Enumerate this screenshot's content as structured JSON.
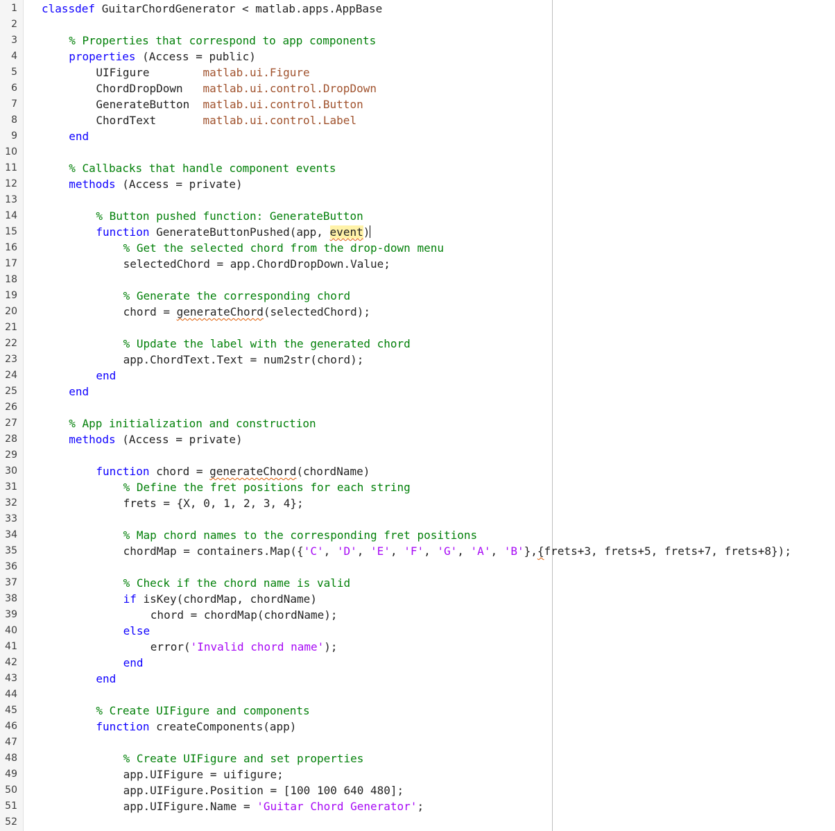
{
  "editor": {
    "line_numbers": [
      "1",
      "2",
      "3",
      "4",
      "5",
      "6",
      "7",
      "8",
      "9",
      "10",
      "11",
      "12",
      "13",
      "14",
      "15",
      "16",
      "17",
      "18",
      "19",
      "20",
      "21",
      "22",
      "23",
      "24",
      "25",
      "26",
      "27",
      "28",
      "29",
      "30",
      "31",
      "32",
      "33",
      "34",
      "35",
      "36",
      "37",
      "38",
      "39",
      "40",
      "41",
      "42",
      "43",
      "44",
      "45",
      "46",
      "47",
      "48",
      "49",
      "50",
      "51",
      "52"
    ],
    "lines": [
      {
        "n": 1,
        "indent": 0,
        "tokens": [
          {
            "t": "classdef",
            "c": "kw"
          },
          {
            "t": " GuitarChordGenerator < matlab.apps.AppBase",
            "c": ""
          }
        ]
      },
      {
        "n": 2,
        "indent": 0,
        "tokens": []
      },
      {
        "n": 3,
        "indent": 4,
        "tokens": [
          {
            "t": "% Properties that correspond to app components",
            "c": "cm"
          }
        ]
      },
      {
        "n": 4,
        "indent": 4,
        "tokens": [
          {
            "t": "properties",
            "c": "kw"
          },
          {
            "t": " (Access = public)",
            "c": ""
          }
        ]
      },
      {
        "n": 5,
        "indent": 8,
        "tokens": [
          {
            "t": "UIFigure        ",
            "c": ""
          },
          {
            "t": "matlab.ui.Figure",
            "c": "ty"
          }
        ]
      },
      {
        "n": 6,
        "indent": 8,
        "tokens": [
          {
            "t": "ChordDropDown   ",
            "c": ""
          },
          {
            "t": "matlab.ui.control.DropDown",
            "c": "ty"
          }
        ]
      },
      {
        "n": 7,
        "indent": 8,
        "tokens": [
          {
            "t": "GenerateButton  ",
            "c": ""
          },
          {
            "t": "matlab.ui.control.Button",
            "c": "ty"
          }
        ]
      },
      {
        "n": 8,
        "indent": 8,
        "tokens": [
          {
            "t": "ChordText       ",
            "c": ""
          },
          {
            "t": "matlab.ui.control.Label",
            "c": "ty"
          }
        ]
      },
      {
        "n": 9,
        "indent": 4,
        "tokens": [
          {
            "t": "end",
            "c": "kw"
          }
        ]
      },
      {
        "n": 10,
        "indent": 0,
        "tokens": []
      },
      {
        "n": 11,
        "indent": 4,
        "tokens": [
          {
            "t": "% Callbacks that handle component events",
            "c": "cm"
          }
        ]
      },
      {
        "n": 12,
        "indent": 4,
        "tokens": [
          {
            "t": "methods",
            "c": "kw"
          },
          {
            "t": " (Access = private)",
            "c": ""
          }
        ]
      },
      {
        "n": 13,
        "indent": 0,
        "tokens": []
      },
      {
        "n": 14,
        "indent": 8,
        "tokens": [
          {
            "t": "% Button pushed function: GenerateButton",
            "c": "cm"
          }
        ]
      },
      {
        "n": 15,
        "indent": 8,
        "tokens": [
          {
            "t": "function",
            "c": "kw"
          },
          {
            "t": " GenerateButtonPushed(app, ",
            "c": ""
          },
          {
            "t": "event",
            "c": "hl squig"
          },
          {
            "t": ")",
            "c": ""
          },
          {
            "t": "",
            "c": "caret"
          }
        ]
      },
      {
        "n": 16,
        "indent": 12,
        "tokens": [
          {
            "t": "% Get the selected chord from the drop-down menu",
            "c": "cm"
          }
        ]
      },
      {
        "n": 17,
        "indent": 12,
        "tokens": [
          {
            "t": "selectedChord = app.ChordDropDown.Value;",
            "c": ""
          }
        ]
      },
      {
        "n": 18,
        "indent": 0,
        "tokens": []
      },
      {
        "n": 19,
        "indent": 12,
        "tokens": [
          {
            "t": "% Generate the corresponding chord",
            "c": "cm"
          }
        ]
      },
      {
        "n": 20,
        "indent": 12,
        "tokens": [
          {
            "t": "chord = ",
            "c": ""
          },
          {
            "t": "generateChord",
            "c": "squig"
          },
          {
            "t": "(selectedChord);",
            "c": ""
          }
        ]
      },
      {
        "n": 21,
        "indent": 0,
        "tokens": []
      },
      {
        "n": 22,
        "indent": 12,
        "tokens": [
          {
            "t": "% Update the label with the generated chord",
            "c": "cm"
          }
        ]
      },
      {
        "n": 23,
        "indent": 12,
        "tokens": [
          {
            "t": "app.ChordText.Text = num2str(chord);",
            "c": ""
          }
        ]
      },
      {
        "n": 24,
        "indent": 8,
        "tokens": [
          {
            "t": "end",
            "c": "kw"
          }
        ]
      },
      {
        "n": 25,
        "indent": 4,
        "tokens": [
          {
            "t": "end",
            "c": "kw"
          }
        ]
      },
      {
        "n": 26,
        "indent": 0,
        "tokens": []
      },
      {
        "n": 27,
        "indent": 4,
        "tokens": [
          {
            "t": "% App initialization and construction",
            "c": "cm"
          }
        ]
      },
      {
        "n": 28,
        "indent": 4,
        "tokens": [
          {
            "t": "methods",
            "c": "kw"
          },
          {
            "t": " (Access = private)",
            "c": ""
          }
        ]
      },
      {
        "n": 29,
        "indent": 0,
        "tokens": []
      },
      {
        "n": 30,
        "indent": 8,
        "tokens": [
          {
            "t": "function",
            "c": "kw"
          },
          {
            "t": " chord = ",
            "c": ""
          },
          {
            "t": "generateChord",
            "c": "squig"
          },
          {
            "t": "(chordName)",
            "c": ""
          }
        ]
      },
      {
        "n": 31,
        "indent": 12,
        "tokens": [
          {
            "t": "% Define the fret positions for each string",
            "c": "cm"
          }
        ]
      },
      {
        "n": 32,
        "indent": 12,
        "tokens": [
          {
            "t": "frets = {X, 0, 1, 2, 3, 4};",
            "c": ""
          }
        ]
      },
      {
        "n": 33,
        "indent": 0,
        "tokens": []
      },
      {
        "n": 34,
        "indent": 12,
        "tokens": [
          {
            "t": "% Map chord names to the corresponding fret positions",
            "c": "cm"
          }
        ]
      },
      {
        "n": 35,
        "indent": 12,
        "tokens": [
          {
            "t": "chordMap = containers.Map({",
            "c": ""
          },
          {
            "t": "'C'",
            "c": "st"
          },
          {
            "t": ", ",
            "c": ""
          },
          {
            "t": "'D'",
            "c": "st"
          },
          {
            "t": ", ",
            "c": ""
          },
          {
            "t": "'E'",
            "c": "st"
          },
          {
            "t": ", ",
            "c": ""
          },
          {
            "t": "'F'",
            "c": "st"
          },
          {
            "t": ", ",
            "c": ""
          },
          {
            "t": "'G'",
            "c": "st"
          },
          {
            "t": ", ",
            "c": ""
          },
          {
            "t": "'A'",
            "c": "st"
          },
          {
            "t": ", ",
            "c": ""
          },
          {
            "t": "'B'",
            "c": "st"
          },
          {
            "t": "},",
            "c": ""
          },
          {
            "t": "{",
            "c": "squig"
          },
          {
            "t": "frets+3, frets+5, frets+7, frets+8});",
            "c": ""
          }
        ]
      },
      {
        "n": 36,
        "indent": 0,
        "tokens": []
      },
      {
        "n": 37,
        "indent": 12,
        "tokens": [
          {
            "t": "% Check if the chord name is valid",
            "c": "cm"
          }
        ]
      },
      {
        "n": 38,
        "indent": 12,
        "tokens": [
          {
            "t": "if",
            "c": "kw"
          },
          {
            "t": " isKey(chordMap, chordName)",
            "c": ""
          }
        ]
      },
      {
        "n": 39,
        "indent": 16,
        "tokens": [
          {
            "t": "chord = chordMap(chordName);",
            "c": ""
          }
        ]
      },
      {
        "n": 40,
        "indent": 12,
        "tokens": [
          {
            "t": "else",
            "c": "kw"
          }
        ]
      },
      {
        "n": 41,
        "indent": 16,
        "tokens": [
          {
            "t": "error(",
            "c": ""
          },
          {
            "t": "'Invalid chord name'",
            "c": "st"
          },
          {
            "t": ");",
            "c": ""
          }
        ]
      },
      {
        "n": 42,
        "indent": 12,
        "tokens": [
          {
            "t": "end",
            "c": "kw"
          }
        ]
      },
      {
        "n": 43,
        "indent": 8,
        "tokens": [
          {
            "t": "end",
            "c": "kw"
          }
        ]
      },
      {
        "n": 44,
        "indent": 0,
        "tokens": []
      },
      {
        "n": 45,
        "indent": 8,
        "tokens": [
          {
            "t": "% Create UIFigure and components",
            "c": "cm"
          }
        ]
      },
      {
        "n": 46,
        "indent": 8,
        "tokens": [
          {
            "t": "function",
            "c": "kw"
          },
          {
            "t": " createComponents(app)",
            "c": ""
          }
        ]
      },
      {
        "n": 47,
        "indent": 0,
        "tokens": []
      },
      {
        "n": 48,
        "indent": 12,
        "tokens": [
          {
            "t": "% Create UIFigure and set properties",
            "c": "cm"
          }
        ]
      },
      {
        "n": 49,
        "indent": 12,
        "tokens": [
          {
            "t": "app.UIFigure = uifigure;",
            "c": ""
          }
        ]
      },
      {
        "n": 50,
        "indent": 12,
        "tokens": [
          {
            "t": "app.UIFigure.Position = [100 100 640 480];",
            "c": ""
          }
        ]
      },
      {
        "n": 51,
        "indent": 12,
        "tokens": [
          {
            "t": "app.UIFigure.Name = ",
            "c": ""
          },
          {
            "t": "'Guitar Chord Generator'",
            "c": "st"
          },
          {
            "t": ";",
            "c": ""
          }
        ]
      },
      {
        "n": 52,
        "indent": 0,
        "tokens": []
      }
    ]
  }
}
